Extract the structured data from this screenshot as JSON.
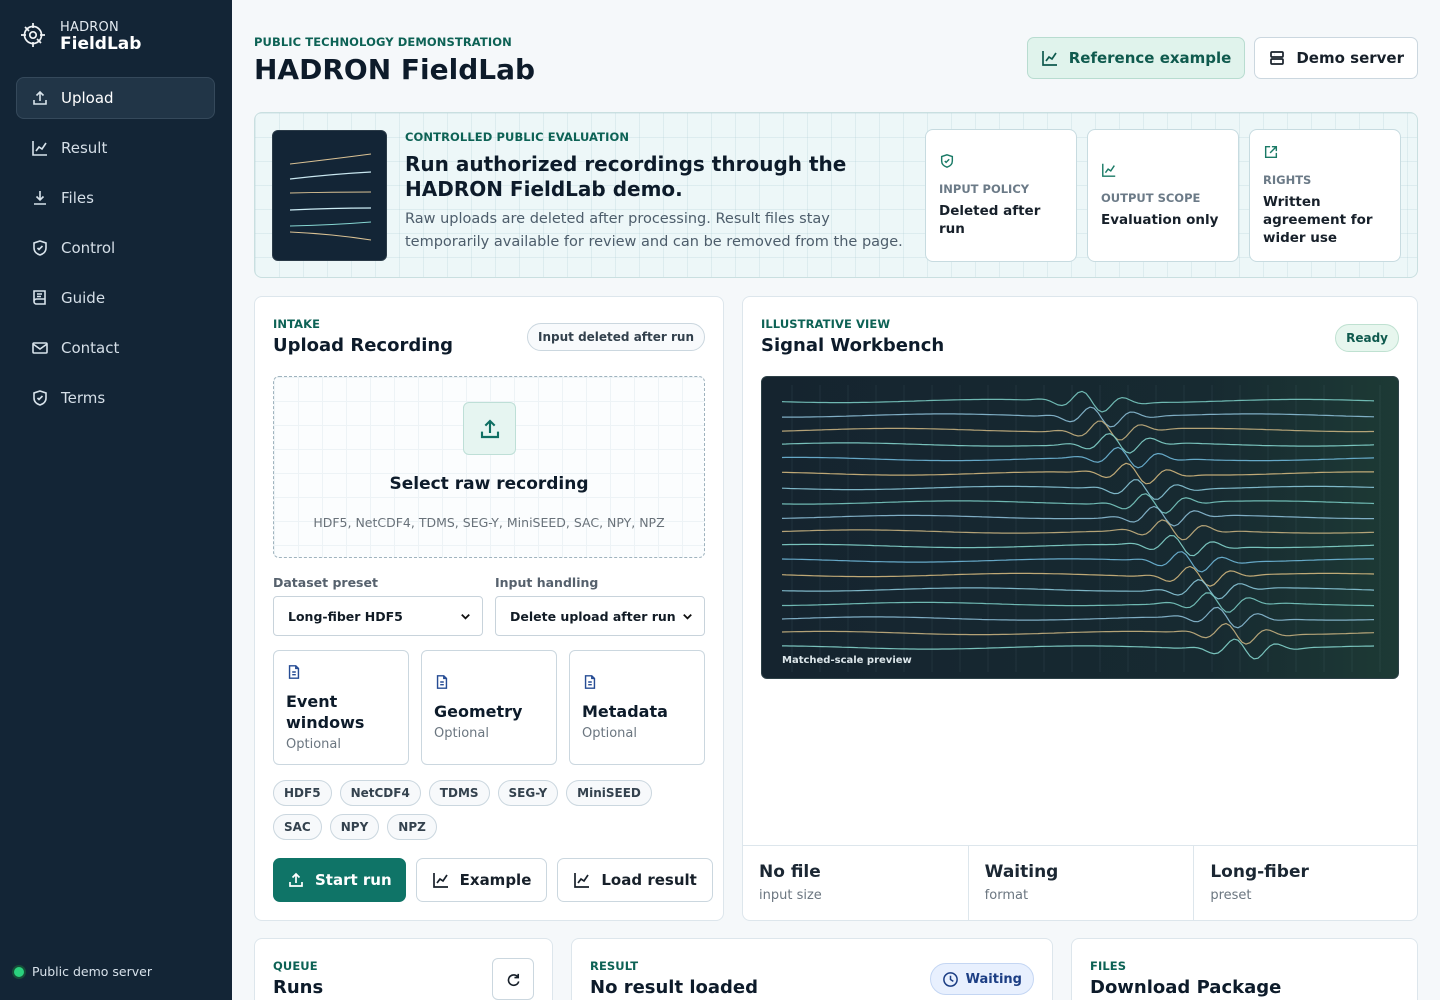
{
  "sidebar": {
    "brand_top": "HADRON",
    "brand_bottom": "FieldLab",
    "items": [
      {
        "label": "Upload",
        "icon": "upload-icon"
      },
      {
        "label": "Result",
        "icon": "chart-icon"
      },
      {
        "label": "Files",
        "icon": "download-icon"
      },
      {
        "label": "Control",
        "icon": "shield-icon"
      },
      {
        "label": "Guide",
        "icon": "book-icon"
      },
      {
        "label": "Contact",
        "icon": "mail-icon"
      },
      {
        "label": "Terms",
        "icon": "shield-icon"
      }
    ],
    "server_status": "Public demo server"
  },
  "header": {
    "eyebrow": "PUBLIC TECHNOLOGY DEMONSTRATION",
    "title": "HADRON FieldLab",
    "reference_example": "Reference example",
    "demo_server": "Demo server"
  },
  "hero": {
    "eyebrow": "CONTROLLED PUBLIC EVALUATION",
    "title": "Run authorized recordings through the HADRON FieldLab demo.",
    "text": "Raw uploads are deleted after processing. Result files stay temporarily available for review and can be removed from the page.",
    "policies": [
      {
        "label": "INPUT POLICY",
        "value": "Deleted after run"
      },
      {
        "label": "OUTPUT SCOPE",
        "value": "Evaluation only"
      },
      {
        "label": "RIGHTS",
        "value": "Written agreement for wider use"
      }
    ]
  },
  "intake": {
    "eyebrow": "INTAKE",
    "title": "Upload Recording",
    "badge": "Input deleted after run",
    "drop_title": "Select raw recording",
    "drop_formats": "HDF5, NetCDF4, TDMS, SEG-Y, MiniSEED, SAC, NPY, NPZ",
    "dataset_preset_label": "Dataset preset",
    "dataset_preset_value": "Long-fiber HDF5",
    "input_handling_label": "Input handling",
    "input_handling_value": "Delete upload after run",
    "docs": [
      {
        "title": "Event windows",
        "sub": "Optional"
      },
      {
        "title": "Geometry",
        "sub": "Optional"
      },
      {
        "title": "Metadata",
        "sub": "Optional"
      }
    ],
    "formats": [
      "HDF5",
      "NetCDF4",
      "TDMS",
      "SEG-Y",
      "MiniSEED",
      "SAC",
      "NPY",
      "NPZ"
    ],
    "start_run": "Start run",
    "example": "Example",
    "load_result": "Load result"
  },
  "workbench": {
    "eyebrow": "ILLUSTRATIVE VIEW",
    "title": "Signal Workbench",
    "status": "Ready",
    "preview_label": "Matched-scale preview",
    "stats": [
      {
        "value": "No file",
        "label": "input size"
      },
      {
        "value": "Waiting",
        "label": "format"
      },
      {
        "value": "Long-fiber",
        "label": "preset"
      }
    ]
  },
  "bottom": {
    "queue_eyebrow": "QUEUE",
    "queue_title": "Runs",
    "result_eyebrow": "RESULT",
    "result_title": "No result loaded",
    "result_status": "Waiting",
    "files_eyebrow": "FILES",
    "files_title": "Download Package"
  },
  "colors": {
    "accent": "#0f7467",
    "sidebar": "#132536",
    "ready": "#e7f6ee"
  }
}
